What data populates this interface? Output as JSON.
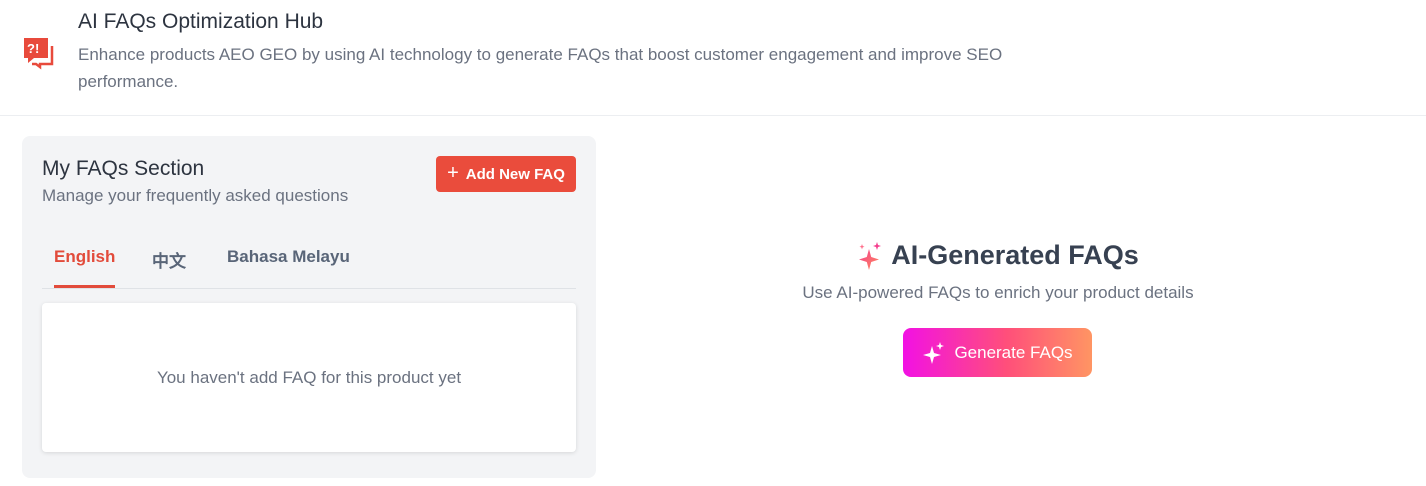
{
  "header": {
    "title": "AI FAQs Optimization Hub",
    "description": "Enhance products AEO GEO by using AI technology to generate FAQs that boost customer engagement and improve SEO performance.",
    "icon": "faq-chat-icon",
    "icon_color": "#e84a3c"
  },
  "faq_card": {
    "title": "My FAQs Section",
    "subtitle": "Manage your frequently asked questions",
    "add_button_label": "Add New FAQ",
    "add_button_icon": "plus-icon",
    "tabs": [
      {
        "label": "English",
        "active": true
      },
      {
        "label": "中文",
        "active": false
      },
      {
        "label": "Bahasa Melayu",
        "active": false
      }
    ],
    "empty_message": "You haven't add FAQ for this product yet"
  },
  "ai_section": {
    "title": "AI-Generated FAQs",
    "title_icon": "sparkles-icon",
    "subtitle": "Use AI-powered FAQs to enrich your product details",
    "generate_button_label": "Generate FAQs",
    "generate_button_icon": "sparkles-icon"
  },
  "colors": {
    "accent": "#ea4c3c",
    "gradient_start": "#f211e4",
    "gradient_end": "#ff9563"
  }
}
